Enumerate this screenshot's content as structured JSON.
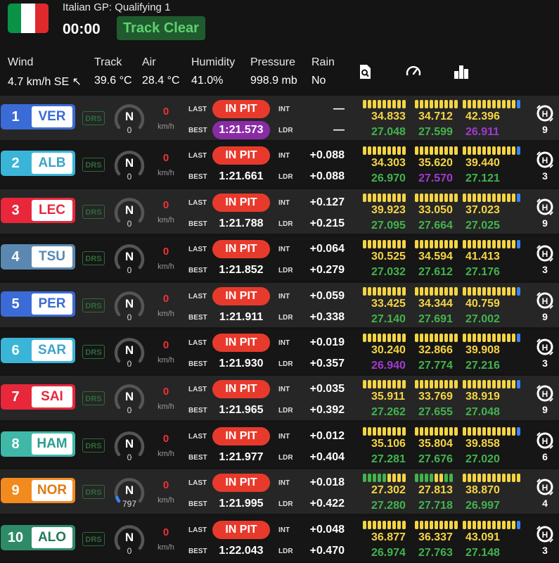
{
  "header": {
    "session": "Italian GP: Qualifying 1",
    "clock": "00:00",
    "track_status": "Track Clear",
    "flag_colors": [
      "#0a9247",
      "#ffffff",
      "#e0292c"
    ],
    "weather": [
      {
        "label": "Wind",
        "value": "4.7 km/h SE ↖"
      },
      {
        "label": "Track",
        "value": "39.6 °C"
      },
      {
        "label": "Air",
        "value": "28.4 °C"
      },
      {
        "label": "Humidity",
        "value": "41.0%"
      },
      {
        "label": "Pressure",
        "value": "998.9 mb"
      },
      {
        "label": "Rain",
        "value": "No"
      }
    ],
    "icons": [
      "search-doc-icon",
      "speedometer-icon",
      "bar-chart-icon"
    ]
  },
  "labels": {
    "drs": "DRS",
    "kmh": "km/h",
    "last": "LAST",
    "best": "BEST",
    "int": "INT",
    "ldr": "LDR"
  },
  "colors": {
    "yellow": "#f5d443",
    "green": "#42b34d",
    "purple": "#a23ad0",
    "blue": "#3b82f6",
    "red": "#e83a2c",
    "drs_off": "#2d6b39"
  },
  "drivers": [
    {
      "pos": "1",
      "code": "VER",
      "team_color": "#3a6bd6",
      "code_color": "#3a6bd6",
      "gear": "N",
      "rpm": "0",
      "speed": "0",
      "last": "IN PIT",
      "best": "1:21.573",
      "best_purple": true,
      "int": "—",
      "ldr": "—",
      "sectors": [
        "34.833",
        "34.712",
        "42.396"
      ],
      "best_sectors": [
        "27.048",
        "27.599",
        "26.911"
      ],
      "best_colors": [
        "green",
        "green",
        "purple"
      ],
      "tyre": "H",
      "laps": "9",
      "bars": [
        "yyyyyyyyy",
        "yyyyyyyyy",
        "yyyyyyyyyyyb"
      ]
    },
    {
      "pos": "2",
      "code": "ALB",
      "team_color": "#3ab5d8",
      "code_color": "#3aa5c8",
      "gear": "N",
      "rpm": "0",
      "speed": "0",
      "last": "IN PIT",
      "best": "1:21.661",
      "best_purple": false,
      "int": "+0.088",
      "ldr": "+0.088",
      "sectors": [
        "34.303",
        "35.620",
        "39.440"
      ],
      "best_sectors": [
        "26.970",
        "27.570",
        "27.121"
      ],
      "best_colors": [
        "green",
        "purple",
        "green"
      ],
      "tyre": "H",
      "laps": "3",
      "bars": [
        "yyyyyyyyy",
        "yyyyyyyyy",
        "yyyyyyyyyyyb"
      ]
    },
    {
      "pos": "3",
      "code": "LEC",
      "team_color": "#e8273b",
      "code_color": "#e8273b",
      "gear": "N",
      "rpm": "0",
      "speed": "0",
      "last": "IN PIT",
      "best": "1:21.788",
      "best_purple": false,
      "int": "+0.127",
      "ldr": "+0.215",
      "sectors": [
        "39.923",
        "33.050",
        "37.023"
      ],
      "best_sectors": [
        "27.095",
        "27.664",
        "27.025"
      ],
      "best_colors": [
        "green",
        "green",
        "green"
      ],
      "tyre": "H",
      "laps": "9",
      "bars": [
        "yyyyyyyyy",
        "yyyyyyyyy",
        "yyyyyyyyyyyb"
      ]
    },
    {
      "pos": "4",
      "code": "TSU",
      "team_color": "#5a88b0",
      "code_color": "#5a88b0",
      "gear": "N",
      "rpm": "0",
      "speed": "0",
      "last": "IN PIT",
      "best": "1:21.852",
      "best_purple": false,
      "int": "+0.064",
      "ldr": "+0.279",
      "sectors": [
        "30.525",
        "34.594",
        "41.413"
      ],
      "best_sectors": [
        "27.032",
        "27.612",
        "27.176"
      ],
      "best_colors": [
        "green",
        "green",
        "green"
      ],
      "tyre": "H",
      "laps": "3",
      "bars": [
        "yyyyyyyyy",
        "yyyyyyyyy",
        "yyyyyyyyyyyb"
      ]
    },
    {
      "pos": "5",
      "code": "PER",
      "team_color": "#3a6bd6",
      "code_color": "#3a6bd6",
      "gear": "N",
      "rpm": "0",
      "speed": "0",
      "last": "IN PIT",
      "best": "1:21.911",
      "best_purple": false,
      "int": "+0.059",
      "ldr": "+0.338",
      "sectors": [
        "33.425",
        "34.344",
        "40.759"
      ],
      "best_sectors": [
        "27.140",
        "27.691",
        "27.002"
      ],
      "best_colors": [
        "green",
        "green",
        "green"
      ],
      "tyre": "H",
      "laps": "9",
      "bars": [
        "yyyyyyyyy",
        "yyyyyyyyy",
        "yyyyyyyyyyyb"
      ]
    },
    {
      "pos": "6",
      "code": "SAR",
      "team_color": "#3ab5d8",
      "code_color": "#3aa5c8",
      "gear": "N",
      "rpm": "0",
      "speed": "0",
      "last": "IN PIT",
      "best": "1:21.930",
      "best_purple": false,
      "int": "+0.019",
      "ldr": "+0.357",
      "sectors": [
        "30.240",
        "32.866",
        "39.908"
      ],
      "best_sectors": [
        "26.940",
        "27.774",
        "27.216"
      ],
      "best_colors": [
        "purple",
        "green",
        "green"
      ],
      "tyre": "H",
      "laps": "3",
      "bars": [
        "yyyyyyyyy",
        "yyyyyyyyy",
        "yyyyyyyyyyyb"
      ]
    },
    {
      "pos": "7",
      "code": "SAI",
      "team_color": "#e8273b",
      "code_color": "#e8273b",
      "gear": "N",
      "rpm": "0",
      "speed": "0",
      "last": "IN PIT",
      "best": "1:21.965",
      "best_purple": false,
      "int": "+0.035",
      "ldr": "+0.392",
      "sectors": [
        "35.911",
        "33.769",
        "38.919"
      ],
      "best_sectors": [
        "27.262",
        "27.655",
        "27.048"
      ],
      "best_colors": [
        "green",
        "green",
        "green"
      ],
      "tyre": "H",
      "laps": "9",
      "bars": [
        "yyyyyyyyy",
        "yyyyyyyyy",
        "yyyyyyyyyyyb"
      ]
    },
    {
      "pos": "8",
      "code": "HAM",
      "team_color": "#3fb8a8",
      "code_color": "#2d9e8f",
      "gear": "N",
      "rpm": "0",
      "speed": "0",
      "last": "IN PIT",
      "best": "1:21.977",
      "best_purple": false,
      "int": "+0.012",
      "ldr": "+0.404",
      "sectors": [
        "35.106",
        "35.804",
        "39.858"
      ],
      "best_sectors": [
        "27.281",
        "27.676",
        "27.020"
      ],
      "best_colors": [
        "green",
        "green",
        "green"
      ],
      "tyre": "H",
      "laps": "6",
      "bars": [
        "yyyyyyyyy",
        "yyyyyyyyy",
        "yyyyyyyyyyyb"
      ]
    },
    {
      "pos": "9",
      "code": "NOR",
      "team_color": "#f28a1e",
      "code_color": "#e07a10",
      "gear": "N",
      "rpm": "797",
      "speed": "0",
      "last": "IN PIT",
      "best": "1:21.995",
      "best_purple": false,
      "int": "+0.018",
      "ldr": "+0.422",
      "sectors": [
        "27.302",
        "27.813",
        "38.870"
      ],
      "best_sectors": [
        "27.280",
        "27.718",
        "26.997"
      ],
      "best_colors": [
        "green",
        "green",
        "green"
      ],
      "tyre": "H",
      "laps": "4",
      "bars": [
        "gggggyyyy",
        "ggggyygg",
        "yyyyyyyyyyyy"
      ]
    },
    {
      "pos": "10",
      "code": "ALO",
      "team_color": "#2e8b68",
      "code_color": "#237a58",
      "gear": "N",
      "rpm": "0",
      "speed": "0",
      "last": "IN PIT",
      "best": "1:22.043",
      "best_purple": false,
      "int": "+0.048",
      "ldr": "+0.470",
      "sectors": [
        "36.877",
        "36.337",
        "43.091"
      ],
      "best_sectors": [
        "26.974",
        "27.763",
        "27.148"
      ],
      "best_colors": [
        "green",
        "green",
        "green"
      ],
      "tyre": "H",
      "laps": "3",
      "bars": [
        "yyyyyyyyy",
        "yyyyyyyyy",
        "yyyyyyyyyyyb"
      ]
    }
  ]
}
